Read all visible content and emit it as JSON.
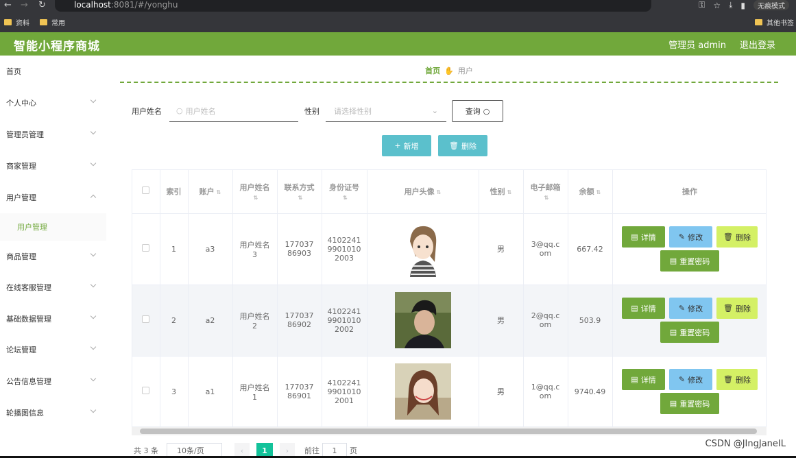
{
  "browser": {
    "url_host": "localhost",
    "url_path": ":8081/#/yonghu",
    "incognito_label": "无痕模式",
    "bookmarks": [
      "资料",
      "常用"
    ],
    "other_bookmarks": "其他书签"
  },
  "header": {
    "brand": "智能小程序商城",
    "admin": "管理员 admin",
    "logout": "退出登录"
  },
  "sidebar": {
    "items": [
      "首页",
      "个人中心",
      "管理员管理",
      "商家管理",
      "用户管理",
      "商品管理",
      "在线客服管理",
      "基础数据管理",
      "论坛管理",
      "公告信息管理",
      "轮播图信息"
    ],
    "submenu": "用户管理"
  },
  "breadcrumb": {
    "home": "首页",
    "current": "用户"
  },
  "search": {
    "name_label": "用户姓名",
    "name_placeholder": "用户姓名",
    "gender_label": "性别",
    "gender_placeholder": "请选择性别",
    "query": "查询"
  },
  "actions": {
    "add": "新增",
    "delete": "删除"
  },
  "table": {
    "headers": [
      "索引",
      "账户",
      "用户姓名",
      "联系方式",
      "身份证号",
      "用户头像",
      "性别",
      "电子邮箱",
      "余额",
      "操作"
    ],
    "rows": [
      {
        "index": "1",
        "account": "a3",
        "name": "用户姓名3",
        "phone": "17703786903",
        "idcard": "410224199010102003",
        "gender": "男",
        "email": "3@qq.com",
        "balance": "667.42"
      },
      {
        "index": "2",
        "account": "a2",
        "name": "用户姓名2",
        "phone": "17703786902",
        "idcard": "410224199010102002",
        "gender": "男",
        "email": "2@qq.com",
        "balance": "503.9"
      },
      {
        "index": "3",
        "account": "a1",
        "name": "用户姓名1",
        "phone": "17703786901",
        "idcard": "410224199010102001",
        "gender": "男",
        "email": "1@qq.com",
        "balance": "9740.49"
      }
    ],
    "op_labels": {
      "detail": "详情",
      "edit": "修改",
      "delete": "删除",
      "reset": "重置密码"
    }
  },
  "pager": {
    "total": "共 3 条",
    "size": "10条/页",
    "current": "1",
    "goto": "前往",
    "goto_value": "1",
    "page": "页"
  },
  "watermark": "CSDN @JIngJaneIL",
  "colors": {
    "primary": "#71a83b",
    "accent": "#5bc0cc",
    "edit": "#80c6f0",
    "danger": "#d4f065",
    "pager": "#13c29a"
  }
}
